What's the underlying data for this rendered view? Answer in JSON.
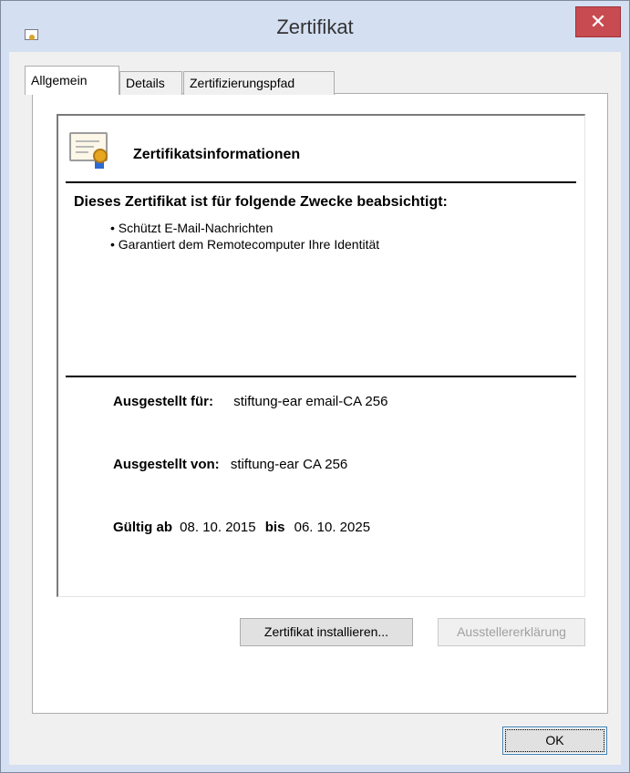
{
  "window": {
    "title": "Zertifikat",
    "close_label": "✕"
  },
  "tabs": [
    {
      "label": "Allgemein",
      "active": true
    },
    {
      "label": "Details",
      "active": false
    },
    {
      "label": "Zertifizierungspfad",
      "active": false
    }
  ],
  "certificate": {
    "info_title": "Zertifikatsinformationen",
    "purpose_heading": "Dieses Zertifikat ist für folgende Zwecke beabsichtigt:",
    "purposes": [
      "Schützt E-Mail-Nachrichten",
      "Garantiert dem Remotecomputer Ihre Identität"
    ],
    "issued_to_label": "Ausgestellt für:",
    "issued_to_value": "stiftung-ear email-CA 256",
    "issued_by_label": "Ausgestellt von:",
    "issued_by_value": "stiftung-ear CA 256",
    "valid_from_label": "Gültig ab",
    "valid_from_value": "08. 10. 2015",
    "valid_to_label": "bis",
    "valid_to_value": "06. 10. 2025"
  },
  "buttons": {
    "install": "Zertifikat installieren...",
    "issuer_statement": "Ausstellererklärung",
    "ok": "OK"
  },
  "icons": {
    "title": "certificate-icon",
    "info": "certificate-icon"
  }
}
